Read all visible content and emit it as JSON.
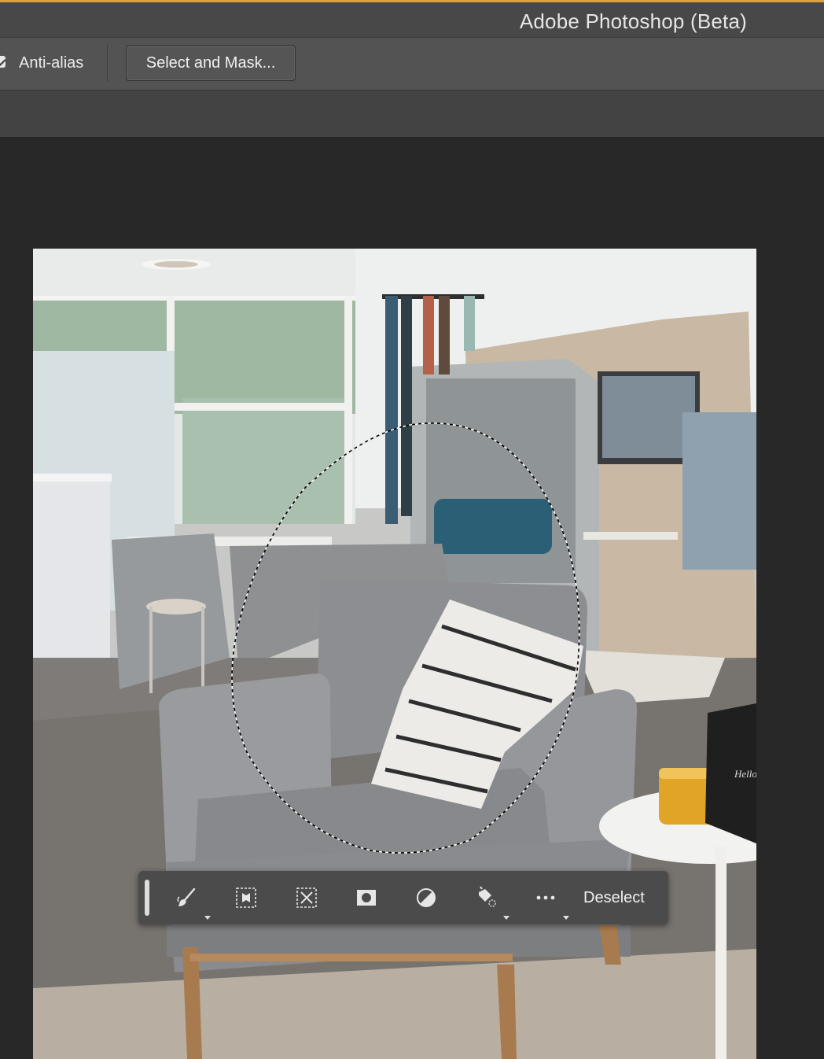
{
  "window": {
    "title": "Adobe Photoshop (Beta)"
  },
  "options_bar": {
    "anti_alias_label": "Anti-alias",
    "anti_alias_checked": true,
    "select_and_mask_label": "Select and Mask..."
  },
  "contextual_task_bar": {
    "tools": [
      {
        "name": "select-brush-icon",
        "has_menu": true
      },
      {
        "name": "select-subject-icon",
        "has_menu": false
      },
      {
        "name": "transform-selection-icon",
        "has_menu": false
      },
      {
        "name": "create-mask-icon",
        "has_menu": false
      },
      {
        "name": "adjustment-layer-icon",
        "has_menu": false
      },
      {
        "name": "fill-selection-icon",
        "has_menu": true
      },
      {
        "name": "more-options-icon",
        "has_menu": true
      }
    ],
    "deselect_label": "Deselect"
  },
  "document": {
    "content": "photo of a gray armchair with striped pillow in an office lounge",
    "selection": "elliptical lasso selection around the pillow",
    "sign_text": "Hello Color"
  },
  "colors": {
    "accent_top_line": "#d9a43a",
    "canvas_background": "#282828",
    "options_bar": "#535353",
    "task_bar": "#4b4b4b"
  }
}
